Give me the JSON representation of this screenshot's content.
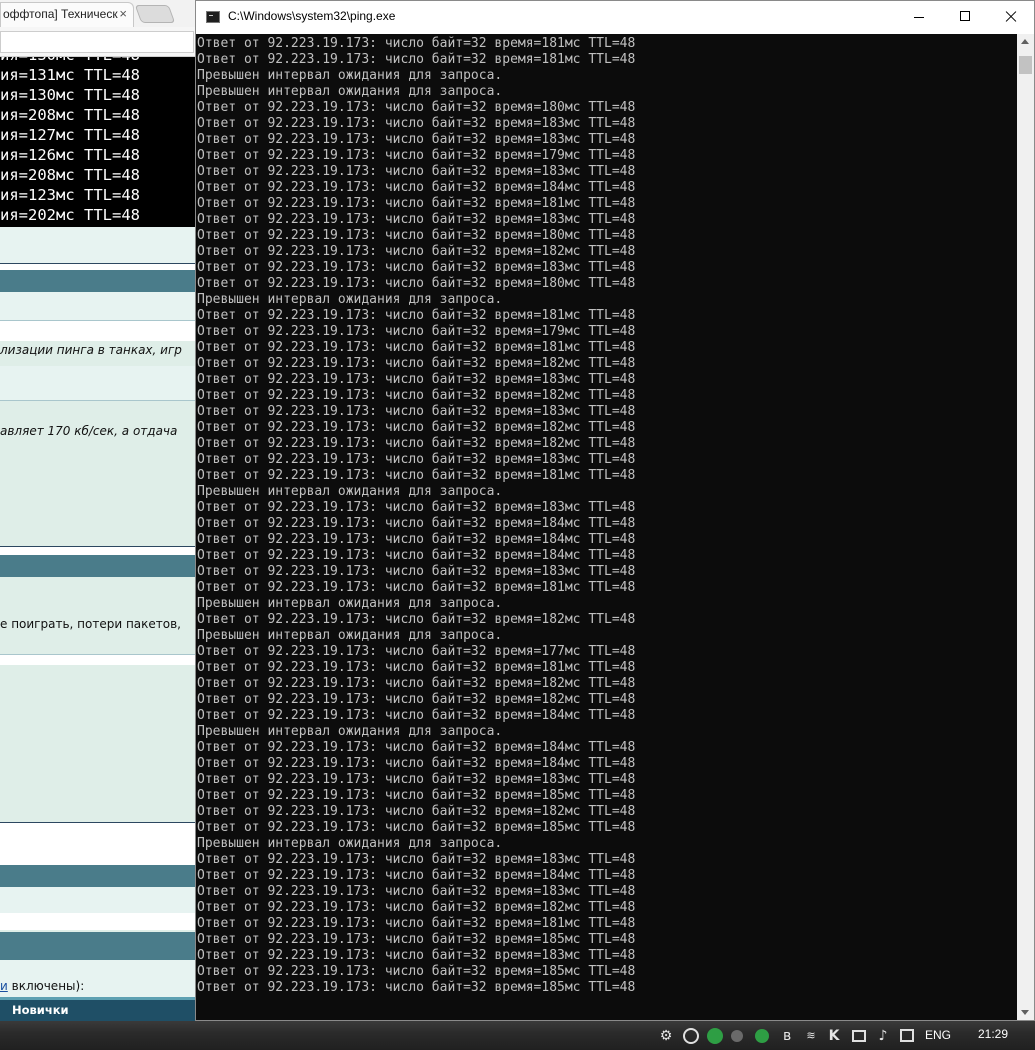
{
  "browser": {
    "tab_title": "оффтопа] Техническ",
    "tab_close": "×",
    "console_first": "ия=130мс TTL=48",
    "console_lines": [
      "ия=131мс TTL=48",
      "ия=130мс TTL=48",
      "ия=208мс TTL=48",
      "ия=127мс TTL=48",
      "ия=126мс TTL=48",
      "ия=208мс TTL=48",
      "ия=123мс TTL=48",
      "ия=202мс TTL=48"
    ],
    "snippet_1": "лизации пинга в танках, игр",
    "snippet_2": "авляет 170 кб/сек, а отдача",
    "snippet_3": "е поиграть, потери пакетов,",
    "snippet_4_link": "и",
    "snippet_4_rest": " включены):",
    "footer_label": "Новички"
  },
  "cmd": {
    "title": "C:\\Windows\\system32\\ping.exe",
    "output": [
      "Ответ от 92.223.19.173: число байт=32 время=181мс TTL=48",
      "Ответ от 92.223.19.173: число байт=32 время=181мс TTL=48",
      "Превышен интервал ожидания для запроса.",
      "Превышен интервал ожидания для запроса.",
      "Ответ от 92.223.19.173: число байт=32 время=180мс TTL=48",
      "Ответ от 92.223.19.173: число байт=32 время=183мс TTL=48",
      "Ответ от 92.223.19.173: число байт=32 время=183мс TTL=48",
      "Ответ от 92.223.19.173: число байт=32 время=179мс TTL=48",
      "Ответ от 92.223.19.173: число байт=32 время=183мс TTL=48",
      "Ответ от 92.223.19.173: число байт=32 время=184мс TTL=48",
      "Ответ от 92.223.19.173: число байт=32 время=181мс TTL=48",
      "Ответ от 92.223.19.173: число байт=32 время=183мс TTL=48",
      "Ответ от 92.223.19.173: число байт=32 время=180мс TTL=48",
      "Ответ от 92.223.19.173: число байт=32 время=182мс TTL=48",
      "Ответ от 92.223.19.173: число байт=32 время=183мс TTL=48",
      "Ответ от 92.223.19.173: число байт=32 время=180мс TTL=48",
      "Превышен интервал ожидания для запроса.",
      "Ответ от 92.223.19.173: число байт=32 время=181мс TTL=48",
      "Ответ от 92.223.19.173: число байт=32 время=179мс TTL=48",
      "Ответ от 92.223.19.173: число байт=32 время=181мс TTL=48",
      "Ответ от 92.223.19.173: число байт=32 время=182мс TTL=48",
      "Ответ от 92.223.19.173: число байт=32 время=183мс TTL=48",
      "Ответ от 92.223.19.173: число байт=32 время=182мс TTL=48",
      "Ответ от 92.223.19.173: число байт=32 время=183мс TTL=48",
      "Ответ от 92.223.19.173: число байт=32 время=182мс TTL=48",
      "Ответ от 92.223.19.173: число байт=32 время=182мс TTL=48",
      "Ответ от 92.223.19.173: число байт=32 время=183мс TTL=48",
      "Ответ от 92.223.19.173: число байт=32 время=181мс TTL=48",
      "Превышен интервал ожидания для запроса.",
      "Ответ от 92.223.19.173: число байт=32 время=183мс TTL=48",
      "Ответ от 92.223.19.173: число байт=32 время=184мс TTL=48",
      "Ответ от 92.223.19.173: число байт=32 время=184мс TTL=48",
      "Ответ от 92.223.19.173: число байт=32 время=184мс TTL=48",
      "Ответ от 92.223.19.173: число байт=32 время=183мс TTL=48",
      "Ответ от 92.223.19.173: число байт=32 время=181мс TTL=48",
      "Превышен интервал ожидания для запроса.",
      "Ответ от 92.223.19.173: число байт=32 время=182мс TTL=48",
      "Превышен интервал ожидания для запроса.",
      "Ответ от 92.223.19.173: число байт=32 время=177мс TTL=48",
      "Ответ от 92.223.19.173: число байт=32 время=181мс TTL=48",
      "Ответ от 92.223.19.173: число байт=32 время=182мс TTL=48",
      "Ответ от 92.223.19.173: число байт=32 время=182мс TTL=48",
      "Ответ от 92.223.19.173: число байт=32 время=184мс TTL=48",
      "Превышен интервал ожидания для запроса.",
      "Ответ от 92.223.19.173: число байт=32 время=184мс TTL=48",
      "Ответ от 92.223.19.173: число байт=32 время=184мс TTL=48",
      "Ответ от 92.223.19.173: число байт=32 время=183мс TTL=48",
      "Ответ от 92.223.19.173: число байт=32 время=185мс TTL=48",
      "Ответ от 92.223.19.173: число байт=32 время=182мс TTL=48",
      "Ответ от 92.223.19.173: число байт=32 время=185мс TTL=48",
      "Превышен интервал ожидания для запроса.",
      "Ответ от 92.223.19.173: число байт=32 время=183мс TTL=48",
      "Ответ от 92.223.19.173: число байт=32 время=184мс TTL=48",
      "Ответ от 92.223.19.173: число байт=32 время=183мс TTL=48",
      "Ответ от 92.223.19.173: число байт=32 время=182мс TTL=48",
      "Ответ от 92.223.19.173: число байт=32 время=181мс TTL=48",
      "Ответ от 92.223.19.173: число байт=32 время=185мс TTL=48",
      "Ответ от 92.223.19.173: число байт=32 время=183мс TTL=48",
      "Ответ от 92.223.19.173: число байт=32 время=185мс TTL=48",
      "Ответ от 92.223.19.173: число байт=32 время=185мс TTL=48"
    ]
  },
  "taskbar": {
    "language": "ENG",
    "time": "21:29",
    "tray_icons": [
      "network-settings-icon",
      "browser-e-icon",
      "color-app-icon",
      "notification-bell-icon",
      "green-check-icon",
      "bluetooth-icon",
      "cpu-icon",
      "kaspersky-icon",
      "network-icon",
      "volume-icon",
      "action-center-icon"
    ]
  },
  "colors": {
    "terminal_bg": "#0c0c0c",
    "terminal_fg": "#c0c0c0",
    "forum_band": "#4a7c8a",
    "forum_light": "#dfeee8",
    "forum_footer": "#1f4f66"
  }
}
